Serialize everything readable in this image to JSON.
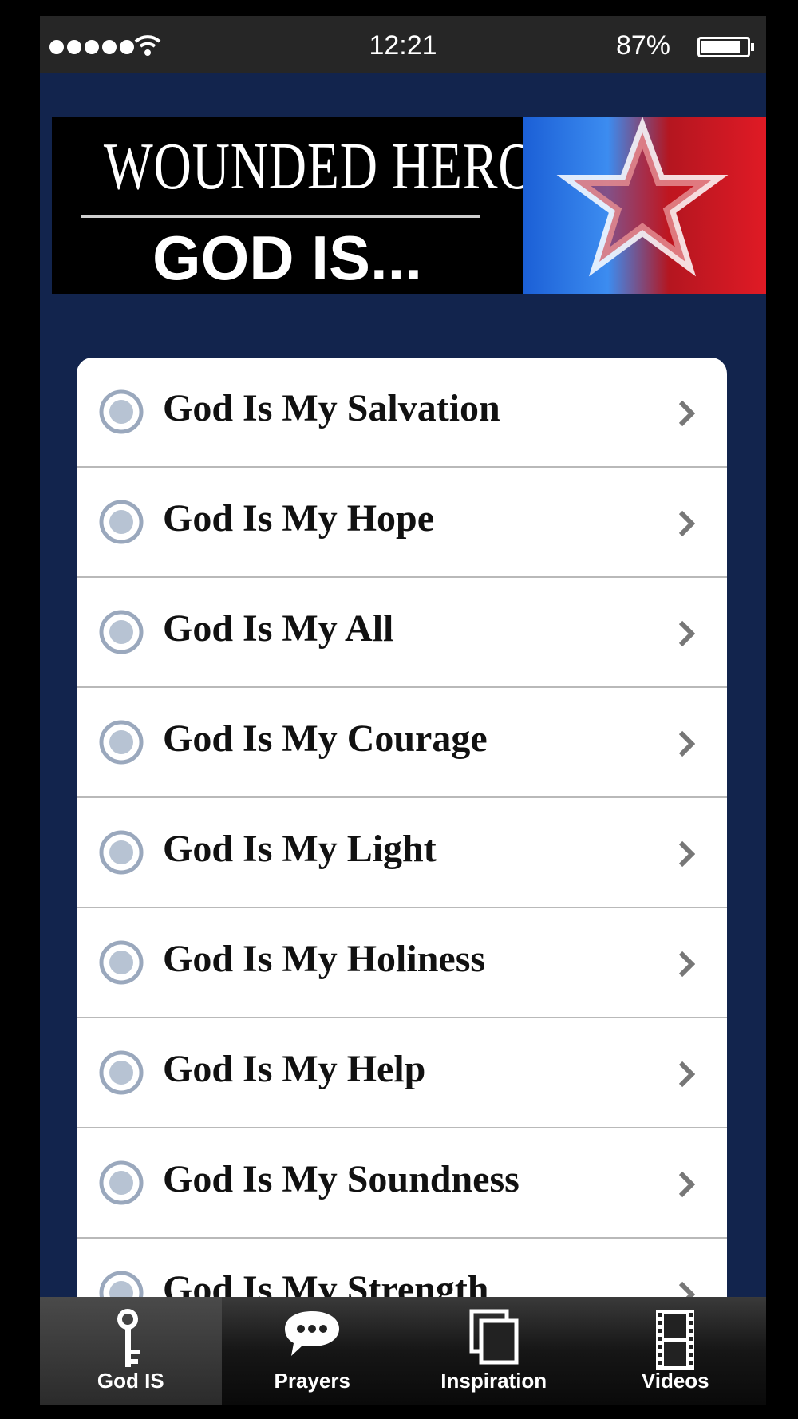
{
  "status_bar": {
    "time": "12:21",
    "battery_percent": "87%",
    "battery_level": 0.87
  },
  "banner": {
    "title": "WOUNDED HEROES",
    "subtitle": "GOD IS..."
  },
  "list": {
    "items": [
      {
        "label": "God Is My Salvation"
      },
      {
        "label": "God Is My Hope"
      },
      {
        "label": "God Is My All"
      },
      {
        "label": "God Is My Courage"
      },
      {
        "label": "God Is My Light"
      },
      {
        "label": "God Is My Holiness"
      },
      {
        "label": "God Is My Help"
      },
      {
        "label": "God Is My Soundness"
      },
      {
        "label": "God Is My Strength"
      }
    ]
  },
  "tabs": [
    {
      "label": "God IS",
      "icon": "key-icon",
      "active": true
    },
    {
      "label": "Prayers",
      "icon": "chat-bubble-icon",
      "active": false
    },
    {
      "label": "Inspiration",
      "icon": "pages-icon",
      "active": false
    },
    {
      "label": "Videos",
      "icon": "film-icon",
      "active": false
    }
  ],
  "colors": {
    "background": "#12244d",
    "status_bar": "#262626",
    "list_bg": "#ffffff"
  }
}
